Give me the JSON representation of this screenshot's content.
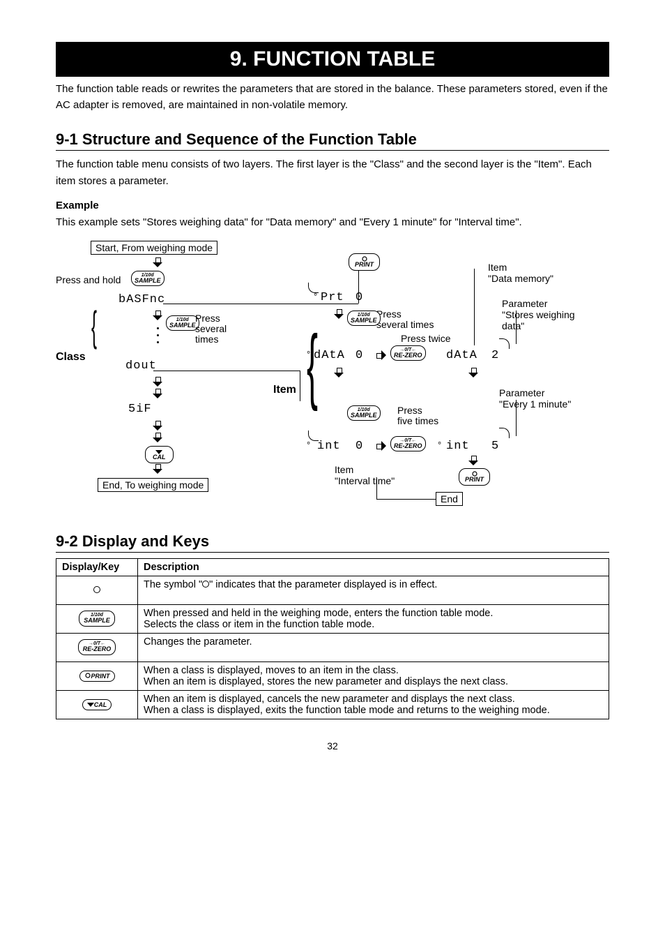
{
  "chapter": {
    "title": "9.  FUNCTION TABLE"
  },
  "intro": "The function table reads or rewrites the parameters that are stored in the balance. These parameters stored, even if the AC adapter is removed, are maintained in non-volatile memory.",
  "section1": {
    "heading": "9-1 Structure and Sequence of the Function Table",
    "text": "The function table menu consists of two layers. The first layer is the \"Class\" and the second layer is the \"Item\". Each item stores a parameter.",
    "example_title": "Example",
    "example_text": "This example sets \"Stores weighing data\" for \"Data memory\" and \"Every 1 minute\" for \"Interval time\"."
  },
  "diagram": {
    "start_box": "Start, From weighing mode",
    "press_and_hold": "Press and hold",
    "class_label": "Class",
    "item_label": "Item",
    "seg_prt": "Prt",
    "seg_basfnc": "bASFnc",
    "seg_data_left": "dAtA",
    "seg_data_right": "dAtA",
    "seg_dout": "dout",
    "seg_sif": "5iF",
    "seg_int_left": "int",
    "seg_int_right": "int",
    "seg_zero": "0",
    "seg_two": "2",
    "seg_five": "5",
    "press_several": "Press\nseveral\ntimes",
    "press_several_times": "Press\nseveral times",
    "press_twice": "Press twice",
    "press_five": "Press\nfive times",
    "item_data_memory": "Item\n\"Data memory\"",
    "param_stores": "Parameter\n\"Stores weighing\ndata\"",
    "param_every1": "Parameter\n\"Every 1 minute\"",
    "item_interval": "Item\n\"Interval time\"",
    "end_label": "End",
    "end_box": "End, To weighing mode",
    "key_sample": "1/10d\nSAMPLE",
    "key_print": "PRINT",
    "key_rezero": "RE-ZERO",
    "key_cal": "CAL"
  },
  "section2": {
    "heading": "9-2  Display and Keys"
  },
  "table": {
    "head_display": "Display/Key",
    "head_desc": "Description",
    "rows": [
      {
        "icon": "circle",
        "desc_pre": "The symbol \"",
        "desc_post": "\" indicates that the parameter displayed is in effect."
      },
      {
        "icon": "sample",
        "desc": "When pressed and held in the weighing mode, enters the function table mode.\nSelects the class or item in the function table mode."
      },
      {
        "icon": "rezero",
        "desc": "Changes the parameter."
      },
      {
        "icon": "print",
        "desc": "When a class is displayed, moves to an item in the class.\nWhen an item is displayed, stores the new parameter and displays the next class."
      },
      {
        "icon": "cal",
        "desc": "When an item is displayed, cancels the new parameter and displays the next class.\nWhen a class is displayed, exits the function table mode and returns to the weighing mode."
      }
    ]
  },
  "page": "32"
}
